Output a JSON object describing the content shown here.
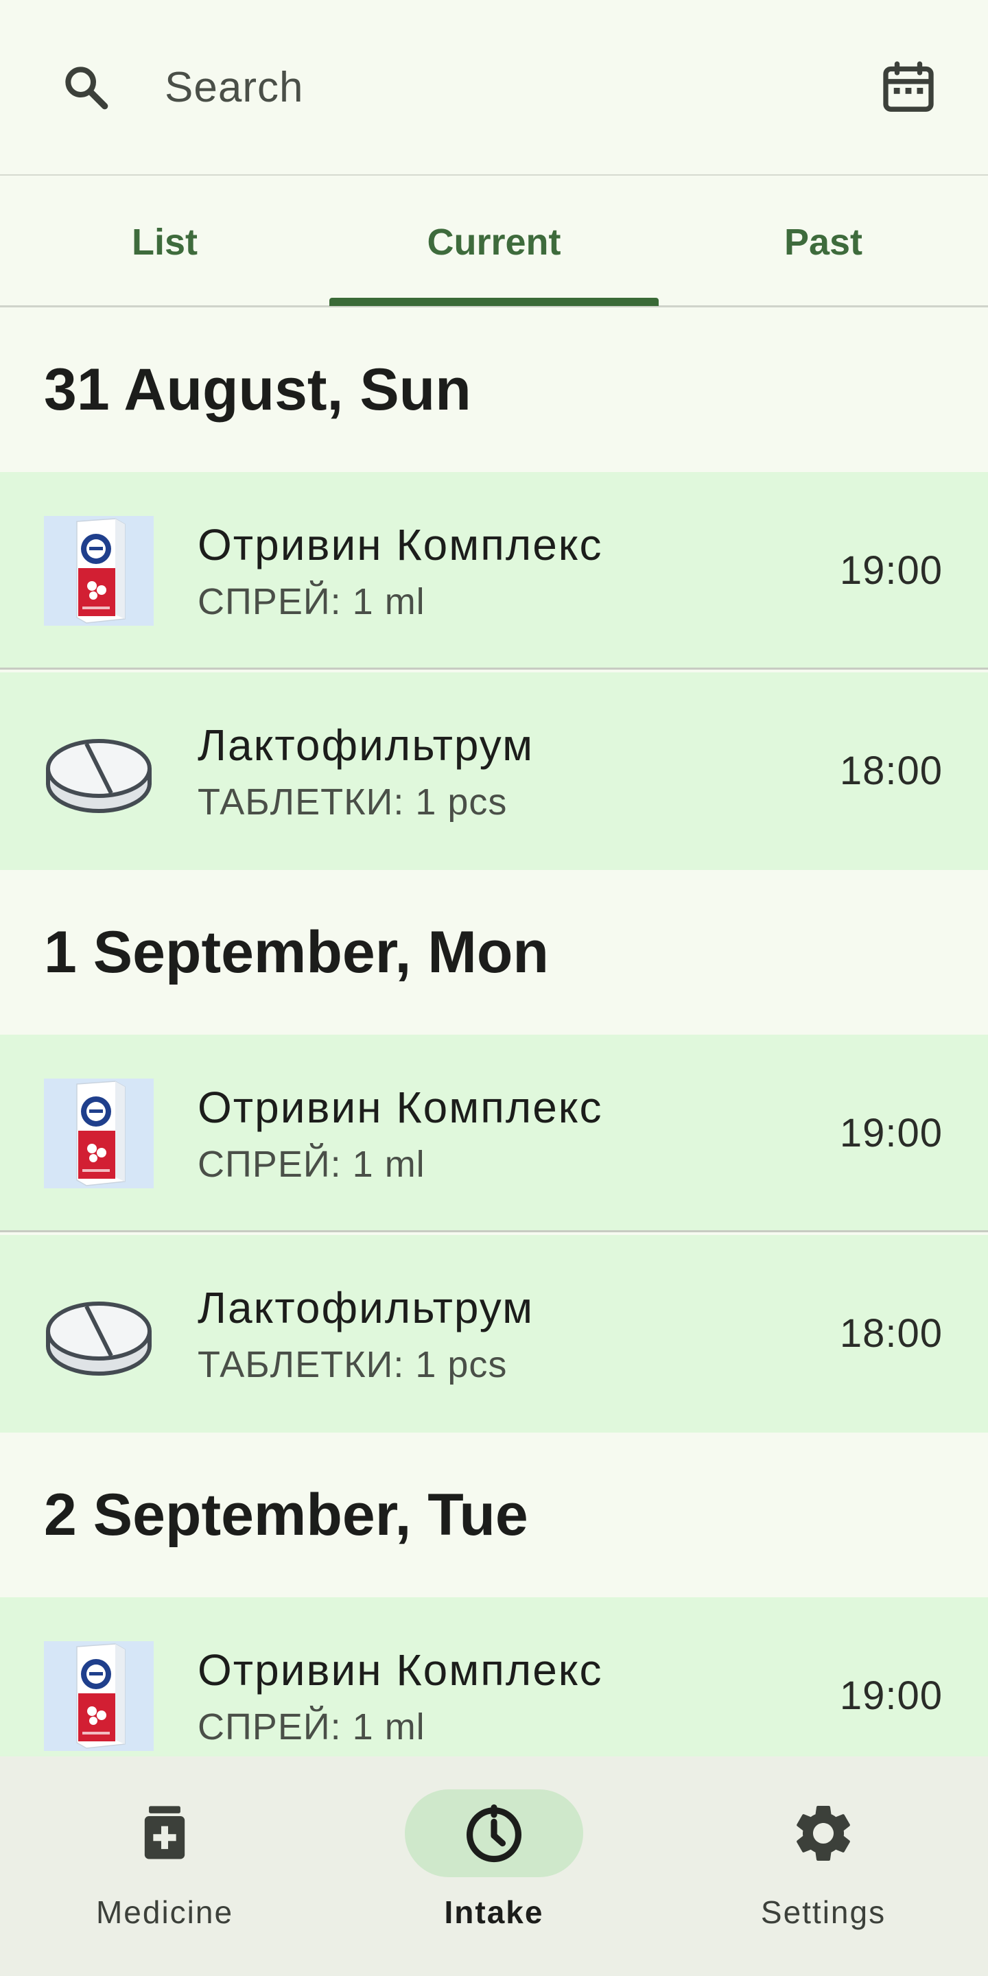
{
  "search": {
    "placeholder": "Search"
  },
  "tabs": [
    {
      "label": "List"
    },
    {
      "label": "Current",
      "selected": true
    },
    {
      "label": "Past"
    }
  ],
  "days": [
    {
      "title": "31 August, Sun",
      "items": [
        {
          "name": "Отривин Комплекс",
          "dose": "СПРЕЙ: 1 ml",
          "time": "19:00",
          "icon": "spray-box-image"
        },
        {
          "name": "Лактофильтрум",
          "dose": "ТАБЛЕТКИ: 1 pcs",
          "time": "18:00",
          "icon": "pill-icon"
        }
      ]
    },
    {
      "title": "1 September, Mon",
      "items": [
        {
          "name": "Отривин Комплекс",
          "dose": "СПРЕЙ: 1 ml",
          "time": "19:00",
          "icon": "spray-box-image"
        },
        {
          "name": "Лактофильтрум",
          "dose": "ТАБЛЕТКИ: 1 pcs",
          "time": "18:00",
          "icon": "pill-icon"
        }
      ]
    },
    {
      "title": "2 September, Tue",
      "items": [
        {
          "name": "Отривин Комплекс",
          "dose": "СПРЕЙ: 1 ml",
          "time": "19:00",
          "icon": "spray-box-image"
        }
      ]
    }
  ],
  "bottom_nav": [
    {
      "label": "Medicine",
      "icon": "medicine-icon"
    },
    {
      "label": "Intake",
      "icon": "clock-icon",
      "selected": true
    },
    {
      "label": "Settings",
      "icon": "gear-icon"
    }
  ],
  "colors": {
    "background": "#f6faf0",
    "accent": "#3a6a37",
    "row_background": "#e0f8dc",
    "nav_background": "#ecefe6"
  }
}
